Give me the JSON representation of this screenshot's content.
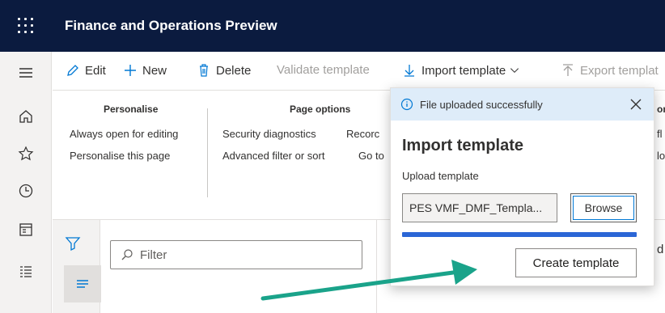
{
  "app": {
    "title": "Finance and Operations Preview"
  },
  "nav": {
    "items": [
      {
        "name": "hamburger-icon"
      },
      {
        "name": "home-icon"
      },
      {
        "name": "star-icon"
      },
      {
        "name": "clock-icon"
      },
      {
        "name": "workspace-icon"
      },
      {
        "name": "modules-list-icon"
      }
    ]
  },
  "actions": {
    "edit": "Edit",
    "new": "New",
    "delete": "Delete",
    "validate": "Validate template",
    "import": "Import template",
    "export": "Export templat"
  },
  "options": {
    "personalise": {
      "title": "Personalise",
      "items": [
        "Always open for editing",
        "Personalise this page"
      ]
    },
    "page_options": {
      "title": "Page options",
      "items": [
        "Security diagnostics",
        "Advanced filter or sort"
      ]
    },
    "col3": {
      "items": [
        "Recorc",
        "Go to"
      ]
    },
    "col4": {
      "title": "on",
      "items": [
        "fl",
        "lo"
      ]
    }
  },
  "filter": {
    "placeholder": "Filter"
  },
  "right_partial": "d",
  "flyout": {
    "banner": "File uploaded successfully",
    "title": "Import template",
    "upload_label": "Upload template",
    "file_value": "PES VMF_DMF_Templa...",
    "browse": "Browse",
    "upload_progress": 1.0,
    "create": "Create template"
  },
  "colors": {
    "topbar": "#0b1b3f",
    "accent": "#0078d4",
    "progress": "#2b66d6",
    "arrow": "#1aa38a",
    "banner": "#deecf9"
  }
}
